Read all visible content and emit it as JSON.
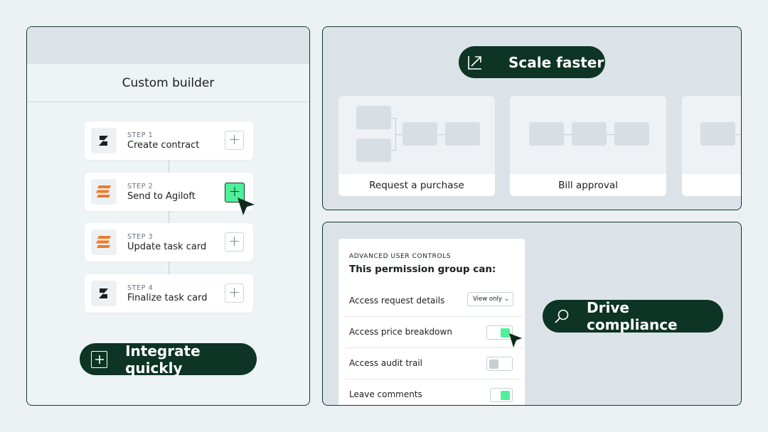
{
  "builder": {
    "title": "Custom builder",
    "steps": [
      {
        "label": "STEP 1",
        "name": "Create contract",
        "logo": "z-logo-icon"
      },
      {
        "label": "STEP 2",
        "name": "Send to Agiloft",
        "logo": "agiloft-logo-icon"
      },
      {
        "label": "STEP 3",
        "name": "Update task card",
        "logo": "agiloft-logo-icon"
      },
      {
        "label": "STEP 4",
        "name": "Finalize task card",
        "logo": "z-logo-icon"
      }
    ],
    "add_symbol": "+",
    "pill": "Integrate quickly",
    "pill_icon": "plus-square-icon"
  },
  "scale": {
    "pill": "Scale faster",
    "pill_icon": "arrow-up-right-icon",
    "cards": [
      "Request a purchase",
      "Bill approval"
    ]
  },
  "compliance": {
    "pill": "Drive compliance",
    "pill_icon": "search-icon",
    "eyebrow": "ADVANCED USER CONTROLS",
    "title": "This permission group can:",
    "rows": [
      {
        "label": "Access request details",
        "control": "select",
        "value": "View only"
      },
      {
        "label": "Access price breakdown",
        "control": "toggle",
        "on": true
      },
      {
        "label": "Access audit trail",
        "control": "toggle",
        "on": false
      },
      {
        "label": "Leave comments",
        "control": "toggle",
        "on": true
      }
    ]
  },
  "colors": {
    "background": "#ebf0f3",
    "accent_dark": "#0d3425",
    "accent_green": "#4ef09a",
    "agiloft_orange": "#f07a2a"
  }
}
